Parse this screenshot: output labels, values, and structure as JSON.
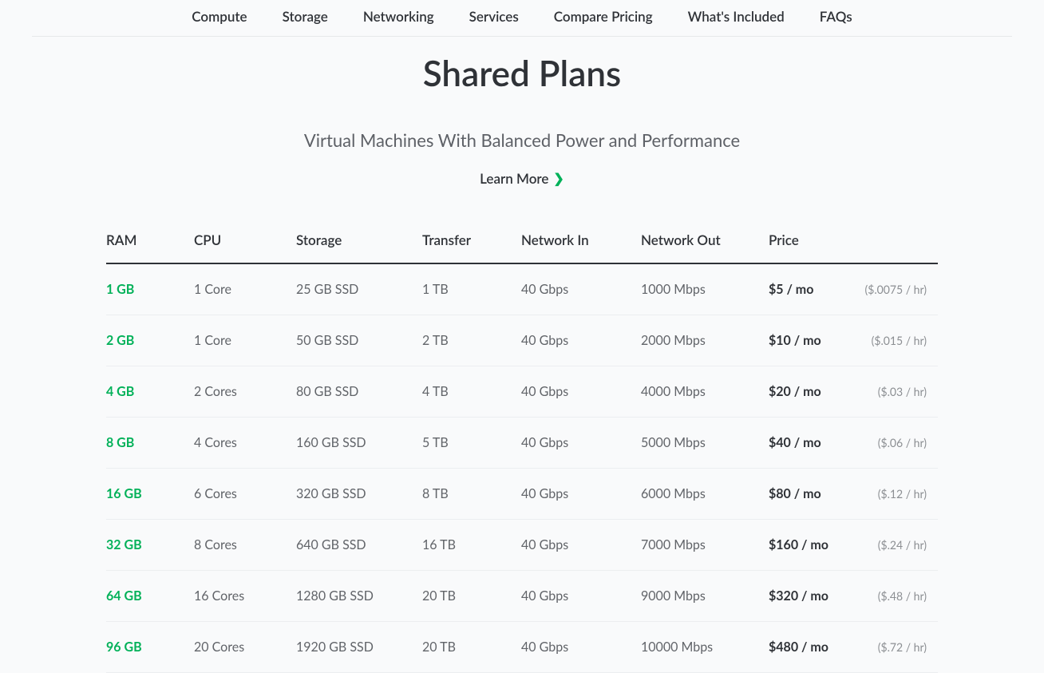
{
  "nav": {
    "items": [
      {
        "label": "Compute"
      },
      {
        "label": "Storage"
      },
      {
        "label": "Networking"
      },
      {
        "label": "Services"
      },
      {
        "label": "Compare Pricing"
      },
      {
        "label": "What's Included"
      },
      {
        "label": "FAQs"
      }
    ]
  },
  "hero": {
    "title": "Shared Plans",
    "subtitle": "Virtual Machines With Balanced Power and Performance",
    "learn_more": "Learn More"
  },
  "table": {
    "headers": {
      "ram": "RAM",
      "cpu": "CPU",
      "storage": "Storage",
      "transfer": "Transfer",
      "network_in": "Network In",
      "network_out": "Network Out",
      "price": "Price"
    },
    "rows": [
      {
        "ram": "1 GB",
        "cpu": "1 Core",
        "storage": "25 GB SSD",
        "transfer": "1 TB",
        "network_in": "40 Gbps",
        "network_out": "1000 Mbps",
        "price_mo": "$5 / mo",
        "price_hr": "($.0075 / hr)"
      },
      {
        "ram": "2 GB",
        "cpu": "1 Core",
        "storage": "50 GB SSD",
        "transfer": "2 TB",
        "network_in": "40 Gbps",
        "network_out": "2000 Mbps",
        "price_mo": "$10 / mo",
        "price_hr": "($.015 / hr)"
      },
      {
        "ram": "4 GB",
        "cpu": "2 Cores",
        "storage": "80 GB SSD",
        "transfer": "4 TB",
        "network_in": "40 Gbps",
        "network_out": "4000 Mbps",
        "price_mo": "$20 / mo",
        "price_hr": "($.03 / hr)"
      },
      {
        "ram": "8 GB",
        "cpu": "4 Cores",
        "storage": "160 GB SSD",
        "transfer": "5 TB",
        "network_in": "40 Gbps",
        "network_out": "5000 Mbps",
        "price_mo": "$40 / mo",
        "price_hr": "($.06 / hr)"
      },
      {
        "ram": "16 GB",
        "cpu": "6 Cores",
        "storage": "320 GB SSD",
        "transfer": "8 TB",
        "network_in": "40 Gbps",
        "network_out": "6000 Mbps",
        "price_mo": "$80 / mo",
        "price_hr": "($.12 / hr)"
      },
      {
        "ram": "32 GB",
        "cpu": "8 Cores",
        "storage": "640 GB SSD",
        "transfer": "16 TB",
        "network_in": "40 Gbps",
        "network_out": "7000 Mbps",
        "price_mo": "$160 / mo",
        "price_hr": "($.24 / hr)"
      },
      {
        "ram": "64 GB",
        "cpu": "16 Cores",
        "storage": "1280 GB SSD",
        "transfer": "20 TB",
        "network_in": "40 Gbps",
        "network_out": "9000 Mbps",
        "price_mo": "$320 / mo",
        "price_hr": "($.48 / hr)"
      },
      {
        "ram": "96 GB",
        "cpu": "20 Cores",
        "storage": "1920 GB SSD",
        "transfer": "20 TB",
        "network_in": "40 Gbps",
        "network_out": "10000 Mbps",
        "price_mo": "$480 / mo",
        "price_hr": "($.72 / hr)"
      }
    ]
  }
}
